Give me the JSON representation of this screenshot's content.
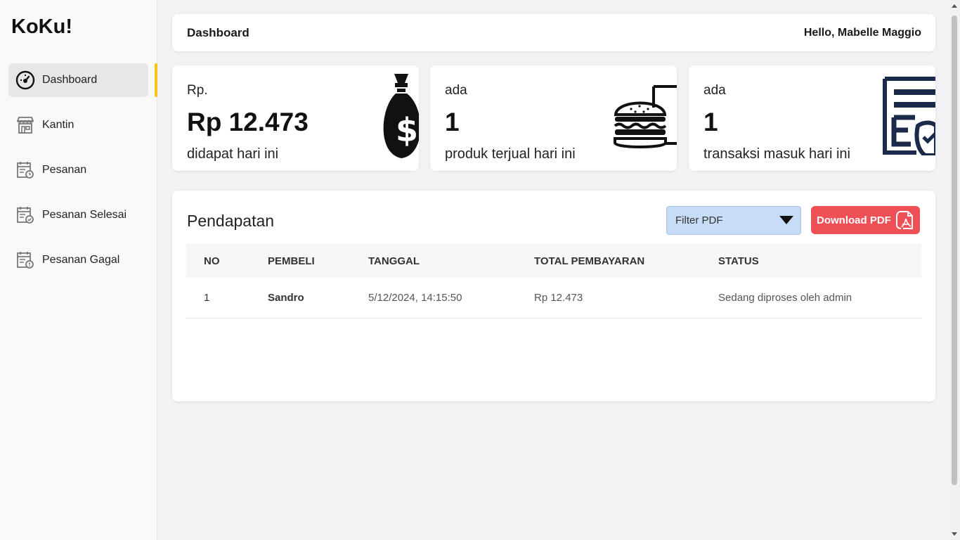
{
  "app": {
    "brand": "KoKu!"
  },
  "sidebar": {
    "items": [
      {
        "label": "Dashboard",
        "icon": "speedometer-icon",
        "active": true
      },
      {
        "label": "Kantin",
        "icon": "store-icon",
        "active": false
      },
      {
        "label": "Pesanan",
        "icon": "calendar-clock-icon",
        "active": false
      },
      {
        "label": "Pesanan Selesai",
        "icon": "calendar-check-icon",
        "active": false
      },
      {
        "label": "Pesanan Gagal",
        "icon": "calendar-alert-icon",
        "active": false
      }
    ],
    "accent_color": "#f5c518"
  },
  "header": {
    "title": "Dashboard",
    "greeting": "Hello, Mabelle Maggio"
  },
  "stats": [
    {
      "pre": "Rp.",
      "value": "Rp 12.473",
      "desc": "didapat hari ini",
      "icon": "money-bag-icon"
    },
    {
      "pre": "ada",
      "value": "1",
      "desc": "produk terjual hari ini",
      "icon": "burger-drink-icon"
    },
    {
      "pre": "ada",
      "value": "1",
      "desc": "transaksi masuk hari ini",
      "icon": "receipt-icon"
    }
  ],
  "income": {
    "title": "Pendapatan",
    "filter": {
      "selected": "Filter PDF"
    },
    "download_label": "Download PDF",
    "download_color": "#ef5055",
    "columns": [
      "NO",
      "PEMBELI",
      "TANGGAL",
      "TOTAL PEMBAYARAN",
      "STATUS"
    ],
    "rows": [
      {
        "no": "1",
        "buyer": "Sandro",
        "date": "5/12/2024, 14:15:50",
        "total": "Rp 12.473",
        "status": "Sedang diproses oleh admin"
      }
    ]
  }
}
